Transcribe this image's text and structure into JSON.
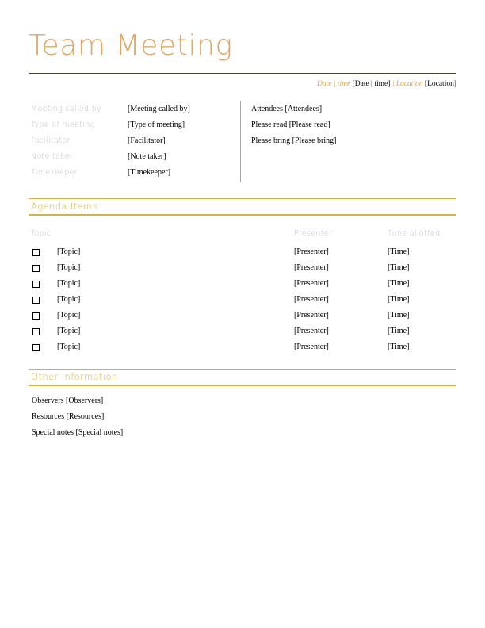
{
  "document": {
    "title": "Team Meeting"
  },
  "meta": {
    "date_label": "Date | time",
    "date_value": "[Date | time]",
    "separator": "|",
    "location_label": "Location",
    "location_value": "[Location]"
  },
  "info": {
    "left_rows": [
      {
        "label": "Meeting called by",
        "value": "[Meeting called by]"
      },
      {
        "label": "Type of meeting",
        "value": "[Type of meeting]"
      },
      {
        "label": "Facilitator",
        "value": "[Facilitator]"
      },
      {
        "label": "Note taker",
        "value": "[Note taker]"
      },
      {
        "label": "Timekeeper",
        "value": "[Timekeeper]"
      }
    ],
    "right_rows": [
      {
        "text": "Attendees [Attendees]"
      },
      {
        "text": "Please read [Please read]"
      },
      {
        "text": "Please bring [Please bring]"
      }
    ]
  },
  "agenda": {
    "section_title": "Agenda Items",
    "columns": {
      "topic": "Topic",
      "presenter": "Presenter",
      "time": "Time allotted"
    },
    "rows": [
      {
        "checked": false,
        "topic": "[Topic]",
        "presenter": "[Presenter]",
        "time": "[Time]"
      },
      {
        "checked": false,
        "topic": "[Topic]",
        "presenter": "[Presenter]",
        "time": "[Time]"
      },
      {
        "checked": false,
        "topic": "[Topic]",
        "presenter": "[Presenter]",
        "time": "[Time]"
      },
      {
        "checked": false,
        "topic": "[Topic]",
        "presenter": "[Presenter]",
        "time": "[Time]"
      },
      {
        "checked": false,
        "topic": "[Topic]",
        "presenter": "[Presenter]",
        "time": "[Time]"
      },
      {
        "checked": false,
        "topic": "[Topic]",
        "presenter": "[Presenter]",
        "time": "[Time]"
      },
      {
        "checked": false,
        "topic": "[Topic]",
        "presenter": "[Presenter]",
        "time": "[Time]"
      }
    ]
  },
  "other": {
    "section_title": "Other Information",
    "lines": [
      {
        "text": "Observers [Observers]"
      },
      {
        "text": "Resources [Resources]"
      },
      {
        "text": "Special notes [Special notes]"
      }
    ]
  },
  "colors": {
    "title": "#E0A863",
    "accent_gold": "#D9B43C",
    "meta_orange": "#D9A441",
    "label_gray": "#BFBFBF",
    "divider_gray": "#A8AA96",
    "rule_dark": "#44462E"
  }
}
